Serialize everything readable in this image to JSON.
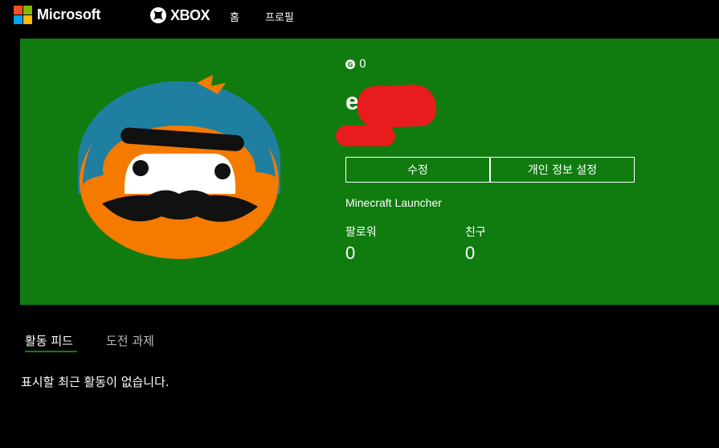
{
  "header": {
    "brand": "Microsoft",
    "xbox_label": "XBOX",
    "nav": [
      {
        "label": "홈"
      },
      {
        "label": "프로필"
      }
    ]
  },
  "profile": {
    "gamerscore": "0",
    "gamerscore_icon_letter": "G",
    "gamertag_visible": "e",
    "edit_button": "수정",
    "privacy_button": "개인 정보 설정",
    "app_presence": "Minecraft Launcher",
    "stats": [
      {
        "label": "팔로워",
        "value": "0"
      },
      {
        "label": "친구",
        "value": "0"
      }
    ]
  },
  "tabs": [
    {
      "label": "활동 피드",
      "active": true
    },
    {
      "label": "도전 과제",
      "active": false
    }
  ],
  "feed": {
    "empty_message": "표시할 최근 활동이 없습니다."
  },
  "colors": {
    "hero_background": "#107c10",
    "redaction": "#e81c1c",
    "avatar_orange": "#f47a00",
    "avatar_blue": "#1f7fa0"
  }
}
